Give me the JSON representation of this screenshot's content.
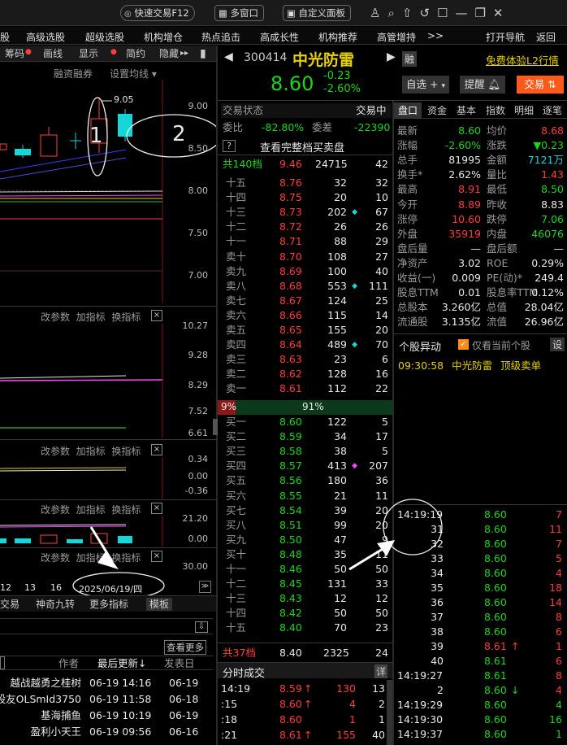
{
  "topbar": {
    "quick_trade": "快速交易F12",
    "multi_window": "多窗口",
    "custom_panel": "自定义面板"
  },
  "menu": {
    "items": [
      "股",
      "高级选股",
      "超级选股",
      "机构增仓",
      "热点追击",
      "高成长性",
      "机构推荐",
      "高管增持"
    ],
    "more": ">>",
    "open_nav": "打开导航",
    "back": "返回"
  },
  "chart_toolbar": {
    "items": [
      "筹码",
      "画线",
      "显示",
      "简约",
      "隐藏"
    ],
    "margin": "融资融券",
    "ma_setting": "设置均线"
  },
  "chart": {
    "price_axis": [
      "9.00",
      "8.50",
      "8.00",
      "7.50",
      "7.00"
    ],
    "candle_label": "9.05",
    "annot1": "1",
    "annot2": "2",
    "ind1_axis": [
      "10.27",
      "9.28",
      "8.29",
      "7.52",
      "6.61"
    ],
    "ind2_axis": [
      "0.34",
      "0.00",
      "-0.36"
    ],
    "ind3_axis": [
      "21.20",
      "0.00"
    ],
    "ind4_axis": [
      "30.00"
    ],
    "ind_ctrl": {
      "params": "改参数",
      "add": "加指标",
      "switch": "换指标",
      "close": "×"
    },
    "dates": [
      "12",
      "13",
      "16"
    ],
    "current_date": "2025/06/19/四",
    "bottom_tabs": [
      "交易",
      "神奇九转",
      "更多指标",
      "模板"
    ]
  },
  "forum": {
    "more": "查看更多",
    "headers": [
      "作者",
      "最后更新↓",
      "发表日"
    ],
    "rows": [
      {
        "author": "越战越勇之桂树",
        "updated": "06-19 14:16",
        "posted": "06-19"
      },
      {
        "author": "股友OLSmId3750",
        "updated": "06-19 11:58",
        "posted": "06-18"
      },
      {
        "author": "基海捕鱼",
        "updated": "06-19 10:19",
        "posted": "06-19"
      },
      {
        "author": "盈利小天王",
        "updated": "06-19 09:56",
        "posted": "06-16"
      }
    ]
  },
  "stock": {
    "code": "300414",
    "name": "中光防雷",
    "price": "8.60",
    "change": "-0.23",
    "pct": "-2.60%",
    "tag": "融",
    "l2": "免费体验L2行情",
    "watch_btn": "自选",
    "alert_btn": "提醒",
    "trade_btn": "交易"
  },
  "orderbook": {
    "state_label": "交易状态",
    "state": "交易中",
    "wb_label": "委比",
    "wb": "-82.80%",
    "wc_label": "委差",
    "wc": "-22390",
    "help": "?",
    "full_link": "查看完整档买卖盘",
    "sell_total": {
      "label": "共140档",
      "price": "9.46",
      "vol": "24715",
      "n": "42"
    },
    "asks": [
      {
        "l": "十五",
        "p": "8.76",
        "v": "32",
        "n": "32",
        "pc": "red"
      },
      {
        "l": "十四",
        "p": "8.75",
        "v": "20",
        "n": "10",
        "pc": "red"
      },
      {
        "l": "十三",
        "p": "8.73",
        "v": "202",
        "n": "67",
        "pc": "red",
        "m": "c"
      },
      {
        "l": "十二",
        "p": "8.72",
        "v": "26",
        "n": "26",
        "pc": "red"
      },
      {
        "l": "十一",
        "p": "8.71",
        "v": "88",
        "n": "29",
        "pc": "red"
      },
      {
        "l": "卖十",
        "p": "8.70",
        "v": "108",
        "n": "27",
        "pc": "red"
      },
      {
        "l": "卖九",
        "p": "8.69",
        "v": "100",
        "n": "40",
        "pc": "red"
      },
      {
        "l": "卖八",
        "p": "8.68",
        "v": "553",
        "n": "111",
        "pc": "red",
        "m": "c"
      },
      {
        "l": "卖七",
        "p": "8.67",
        "v": "124",
        "n": "25",
        "pc": "red"
      },
      {
        "l": "卖六",
        "p": "8.66",
        "v": "115",
        "n": "14",
        "pc": "red"
      },
      {
        "l": "卖五",
        "p": "8.65",
        "v": "155",
        "n": "20",
        "pc": "red"
      },
      {
        "l": "卖四",
        "p": "8.64",
        "v": "489",
        "n": "70",
        "pc": "red",
        "m": "c"
      },
      {
        "l": "卖三",
        "p": "8.63",
        "v": "23",
        "n": "6",
        "pc": "red"
      },
      {
        "l": "卖二",
        "p": "8.62",
        "v": "128",
        "n": "16",
        "pc": "red"
      },
      {
        "l": "卖一",
        "p": "8.61",
        "v": "112",
        "n": "22",
        "pc": "red"
      }
    ],
    "bar": {
      "left": "9%",
      "mid": "91%"
    },
    "bids": [
      {
        "l": "买一",
        "p": "8.60",
        "v": "122",
        "n": "5",
        "pc": "grn"
      },
      {
        "l": "买二",
        "p": "8.59",
        "v": "34",
        "n": "17",
        "pc": "grn"
      },
      {
        "l": "买三",
        "p": "8.58",
        "v": "38",
        "n": "5",
        "pc": "grn"
      },
      {
        "l": "买四",
        "p": "8.57",
        "v": "413",
        "n": "207",
        "pc": "grn",
        "m": "m"
      },
      {
        "l": "买五",
        "p": "8.56",
        "v": "180",
        "n": "36",
        "pc": "grn"
      },
      {
        "l": "买六",
        "p": "8.55",
        "v": "21",
        "n": "11",
        "pc": "grn"
      },
      {
        "l": "买七",
        "p": "8.54",
        "v": "39",
        "n": "20",
        "pc": "grn"
      },
      {
        "l": "买八",
        "p": "8.51",
        "v": "99",
        "n": "20",
        "pc": "grn"
      },
      {
        "l": "买九",
        "p": "8.50",
        "v": "47",
        "n": "9",
        "pc": "grn"
      },
      {
        "l": "买十",
        "p": "8.48",
        "v": "35",
        "n": "11",
        "pc": "grn"
      },
      {
        "l": "十一",
        "p": "8.46",
        "v": "50",
        "n": "50",
        "pc": "grn"
      },
      {
        "l": "十二",
        "p": "8.45",
        "v": "131",
        "n": "33",
        "pc": "grn"
      },
      {
        "l": "十三",
        "p": "8.43",
        "v": "12",
        "n": "12",
        "pc": "grn"
      },
      {
        "l": "十四",
        "p": "8.42",
        "v": "50",
        "n": "50",
        "pc": "grn"
      },
      {
        "l": "十五",
        "p": "8.40",
        "v": "70",
        "n": "23",
        "pc": "grn"
      }
    ],
    "buy_total": {
      "label": "共37档",
      "price": "8.40",
      "vol": "2325",
      "n": "24"
    }
  },
  "ticks_bottom": {
    "title": "分时成交",
    "detail": "详",
    "rows": [
      {
        "t": "14:19",
        "p": "8.59",
        "a": "↑",
        "v": "130",
        "n": "13",
        "c": "red"
      },
      {
        "t": ":15",
        "p": "8.60",
        "a": "↑",
        "v": "4",
        "n": "2",
        "c": "red"
      },
      {
        "t": ":18",
        "p": "8.60",
        "a": "",
        "v": "1",
        "n": "1",
        "c": "red"
      },
      {
        "t": ":21",
        "p": "8.61",
        "a": "↑",
        "v": "155",
        "n": "40",
        "c": "red"
      }
    ]
  },
  "quote": {
    "tabs": [
      "盘口",
      "资金",
      "基本",
      "指数",
      "明细",
      "逐笔"
    ],
    "rows": [
      [
        {
          "k": "最新",
          "v": "8.60",
          "c": "grn"
        },
        {
          "k": "均价",
          "v": "8.68",
          "c": "red"
        }
      ],
      [
        {
          "k": "涨幅",
          "v": "-2.60%",
          "c": "grn"
        },
        {
          "k": "涨跌",
          "v": "▼0.23",
          "c": "grn"
        }
      ],
      [
        {
          "k": "总手",
          "v": "81995",
          "c": "wht"
        },
        {
          "k": "金额",
          "v": "7121万",
          "c": "cyan"
        }
      ],
      [
        {
          "k": "换手*",
          "v": "2.62%",
          "c": "wht"
        },
        {
          "k": "量比",
          "v": "1.43",
          "c": "red"
        }
      ],
      [
        {
          "k": "最高",
          "v": "8.91",
          "c": "red"
        },
        {
          "k": "最低",
          "v": "8.50",
          "c": "grn"
        }
      ],
      [
        {
          "k": "今开",
          "v": "8.89",
          "c": "red"
        },
        {
          "k": "昨收",
          "v": "8.83",
          "c": "wht"
        }
      ],
      [
        {
          "k": "涨停",
          "v": "10.60",
          "c": "red"
        },
        {
          "k": "跌停",
          "v": "7.06",
          "c": "grn"
        }
      ],
      [
        {
          "k": "外盘",
          "v": "35919",
          "c": "red"
        },
        {
          "k": "内盘",
          "v": "46076",
          "c": "grn"
        }
      ],
      [
        {
          "k": "盘后量",
          "v": "—",
          "c": "wht"
        },
        {
          "k": "盘后额",
          "v": "—",
          "c": "wht"
        }
      ],
      [
        {
          "k": "净资产",
          "v": "3.02",
          "c": "wht"
        },
        {
          "k": "ROE",
          "v": "0.29%",
          "c": "wht"
        }
      ],
      [
        {
          "k": "收益(一)",
          "v": "0.009",
          "c": "wht"
        },
        {
          "k": "PE(动)*",
          "v": "249.4",
          "c": "wht"
        }
      ],
      [
        {
          "k": "股息TTM",
          "v": "0.01",
          "c": "wht"
        },
        {
          "k": "股息率TTM",
          "v": "0.12%",
          "c": "wht"
        }
      ],
      [
        {
          "k": "总股本",
          "v": "3.260亿",
          "c": "wht"
        },
        {
          "k": "总值",
          "v": "28.04亿",
          "c": "wht"
        }
      ],
      [
        {
          "k": "流通股",
          "v": "3.135亿",
          "c": "wht"
        },
        {
          "k": "流值",
          "v": "26.96亿",
          "c": "wht"
        }
      ]
    ]
  },
  "moves": {
    "title": "个股异动",
    "check": "仅看当前个股",
    "settings": "设",
    "event": {
      "time": "09:30:58",
      "name": "中光防雷",
      "type": "顶级卖单"
    }
  },
  "ticks_right": [
    {
      "t": "14:19:19",
      "p": "8.60",
      "v": "7"
    },
    {
      "t": "31",
      "p": "8.60",
      "v": "11"
    },
    {
      "t": "32",
      "p": "8.60",
      "v": "7"
    },
    {
      "t": "33",
      "p": "8.60",
      "v": "5"
    },
    {
      "t": "34",
      "p": "8.60",
      "v": "4"
    },
    {
      "t": "35",
      "p": "8.60",
      "v": "18"
    },
    {
      "t": "36",
      "p": "8.60",
      "v": "14"
    },
    {
      "t": "37",
      "p": "8.60",
      "v": "8"
    },
    {
      "t": "38",
      "p": "8.60",
      "v": "6"
    },
    {
      "t": "39",
      "p": "8.61",
      "v": "1",
      "a": "↑",
      "pc": "red"
    },
    {
      "t": "40",
      "p": "8.61",
      "v": "6"
    },
    {
      "t": "14:19:27",
      "p": "8.61",
      "v": "8"
    },
    {
      "t": "2",
      "p": "8.60",
      "v": "4",
      "a": "↓"
    },
    {
      "t": "14:19:29",
      "p": "8.60",
      "v": "4",
      "vc": "grn"
    },
    {
      "t": "14:19:30",
      "p": "8.60",
      "v": "16",
      "vc": "grn"
    },
    {
      "t": "14:19:37",
      "p": "8.60",
      "v": "1",
      "vc": "grn"
    }
  ]
}
